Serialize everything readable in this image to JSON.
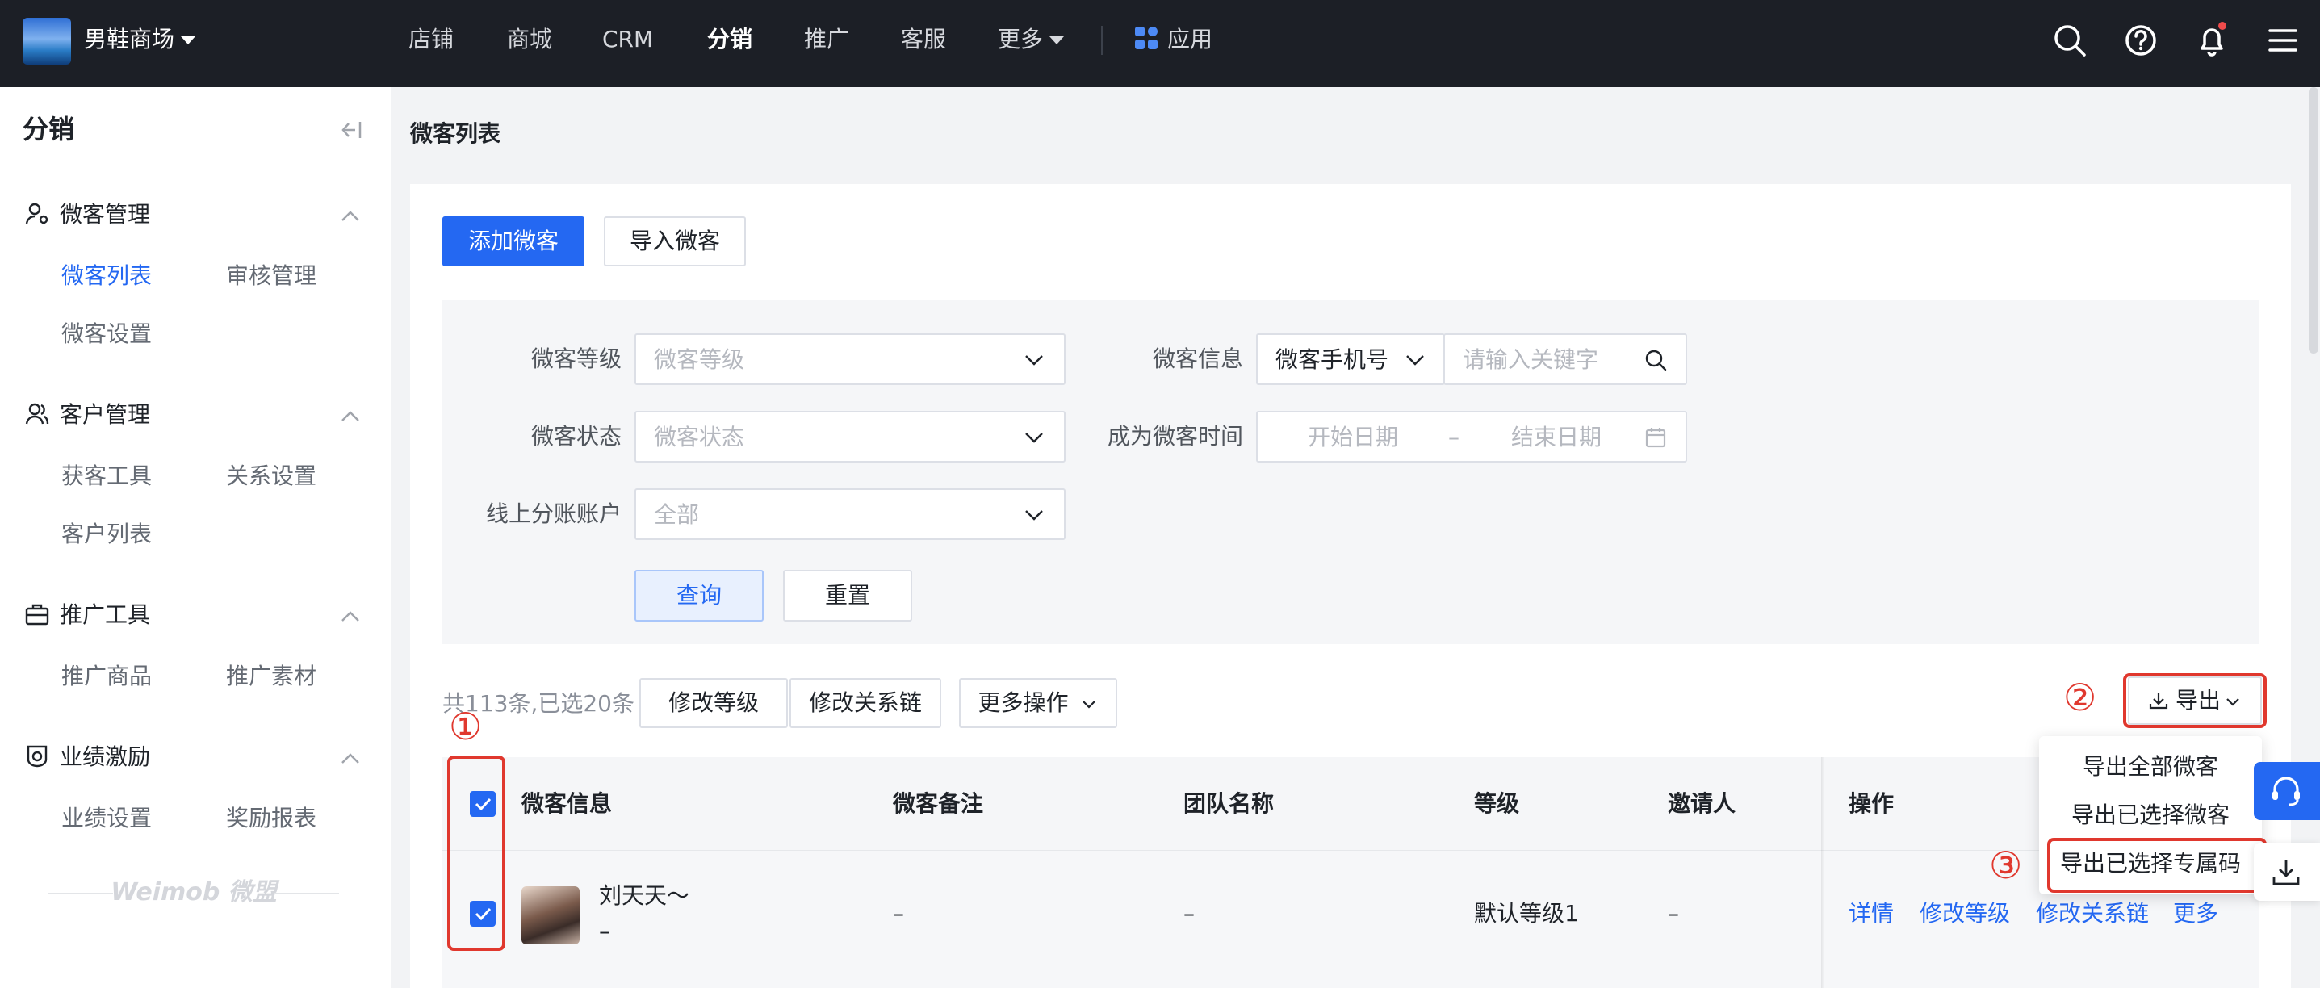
{
  "topbar": {
    "shop_name": "男鞋商场",
    "nav": [
      "店铺",
      "商城",
      "CRM",
      "分销",
      "推广",
      "客服",
      "更多"
    ],
    "active_nav": "分销",
    "apps_label": "应用",
    "icons": [
      "search-icon",
      "help-icon",
      "bell-icon",
      "menu-icon"
    ],
    "notification_dot_color": "#f04b4b"
  },
  "sidebar": {
    "title": "分销",
    "groups": [
      {
        "label": "微客管理",
        "icon": "user-settings-icon",
        "items": [
          "微客列表",
          "审核管理",
          "微客设置"
        ],
        "active_item": "微客列表"
      },
      {
        "label": "客户管理",
        "icon": "user-icon",
        "items": [
          "获客工具",
          "关系设置",
          "客户列表"
        ]
      },
      {
        "label": "推广工具",
        "icon": "toolbox-icon",
        "items": [
          "推广商品",
          "推广素材"
        ]
      },
      {
        "label": "业绩激励",
        "icon": "medal-icon",
        "items": [
          "业绩设置",
          "奖励报表"
        ]
      }
    ],
    "footer_brand": "Weimob 微盟"
  },
  "page": {
    "title": "微客列表",
    "add_button": "添加微客",
    "import_button": "导入微客"
  },
  "filters": {
    "level_label": "微客等级",
    "level_placeholder": "微客等级",
    "info_label": "微客信息",
    "info_select": "微客手机号",
    "info_placeholder": "请输入关键字",
    "status_label": "微客状态",
    "status_placeholder": "微客状态",
    "time_label": "成为微客时间",
    "start_placeholder": "开始日期",
    "range_sep": "–",
    "end_placeholder": "结束日期",
    "account_label": "线上分账账户",
    "account_value": "全部",
    "query_button": "查询",
    "reset_button": "重置"
  },
  "toolbar": {
    "summary": "共113条,已选20条",
    "modify_level": "修改等级",
    "modify_chain": "修改关系链",
    "more_ops": "更多操作",
    "export": "导出"
  },
  "export_menu": [
    "导出全部微客",
    "导出已选择微客",
    "导出已选择专属码"
  ],
  "annotations": {
    "one": "①",
    "two": "②",
    "three": "③",
    "color": "#e0382e"
  },
  "table": {
    "headers": [
      "微客信息",
      "微客备注",
      "团队名称",
      "等级",
      "邀请人",
      "操作"
    ],
    "rows": [
      {
        "name": "刘天天～",
        "sub": "–",
        "remark": "–",
        "team": "–",
        "level": "默认等级1",
        "inviter": "–",
        "selected": true,
        "actions": [
          "详情",
          "修改等级",
          "修改关系链",
          "更多"
        ]
      }
    ]
  },
  "colors": {
    "primary": "#2468f2",
    "topbar": "#1c1f26"
  }
}
